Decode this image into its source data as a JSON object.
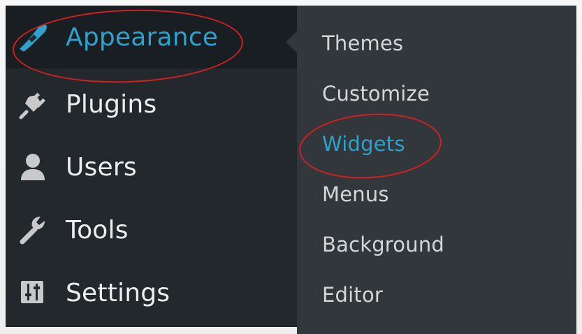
{
  "colors": {
    "sidebar_bg": "#23282d",
    "submenu_bg": "#32373c",
    "current_item_bg": "#191e23",
    "accent": "#2ea2cc",
    "text": "#eeeeee",
    "annotation": "#d32020"
  },
  "sidebar": {
    "items": [
      {
        "label": "Appearance",
        "icon": "paintbrush-icon",
        "current": true
      },
      {
        "label": "Plugins",
        "icon": "plug-icon",
        "current": false
      },
      {
        "label": "Users",
        "icon": "user-icon",
        "current": false
      },
      {
        "label": "Tools",
        "icon": "wrench-icon",
        "current": false
      },
      {
        "label": "Settings",
        "icon": "sliders-icon",
        "current": false
      }
    ]
  },
  "submenu": {
    "items": [
      {
        "label": "Themes",
        "active": false
      },
      {
        "label": "Customize",
        "active": false
      },
      {
        "label": "Widgets",
        "active": true
      },
      {
        "label": "Menus",
        "active": false
      },
      {
        "label": "Background",
        "active": false
      },
      {
        "label": "Editor",
        "active": false
      }
    ]
  }
}
